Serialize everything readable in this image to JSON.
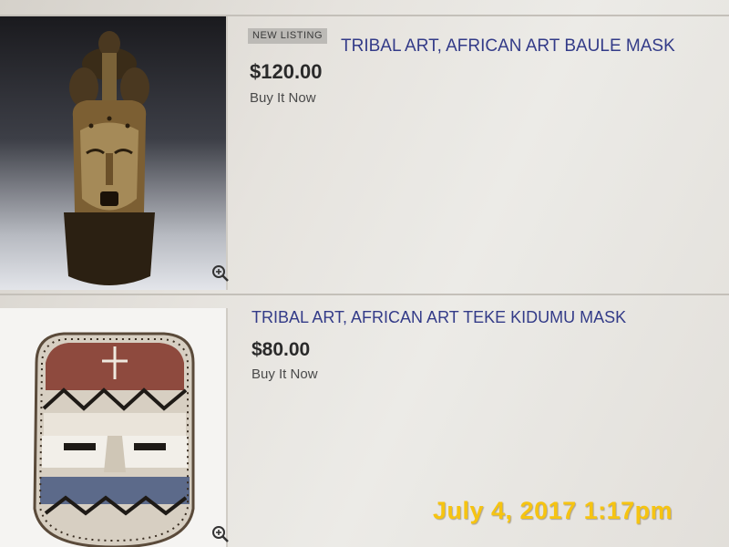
{
  "listings": [
    {
      "badge": "NEW LISTING",
      "title": "TRIBAL ART, AFRICAN ART BAULE MASK",
      "price": "$120.00",
      "format": "Buy It Now",
      "image_icon": "baule-mask-photo",
      "zoom_icon": "zoom-in-icon"
    },
    {
      "title": "TRIBAL ART, AFRICAN ART TEKE KIDUMU MASK",
      "price": "$80.00",
      "format": "Buy It Now",
      "image_icon": "teke-kidumu-mask-photo",
      "zoom_icon": "zoom-in-icon"
    }
  ],
  "photo_timestamp": "July 4, 2017 1:17pm",
  "colors": {
    "title_link": "#333b88",
    "badge_bg": "#bcbab6",
    "timestamp": "#f6c411"
  }
}
